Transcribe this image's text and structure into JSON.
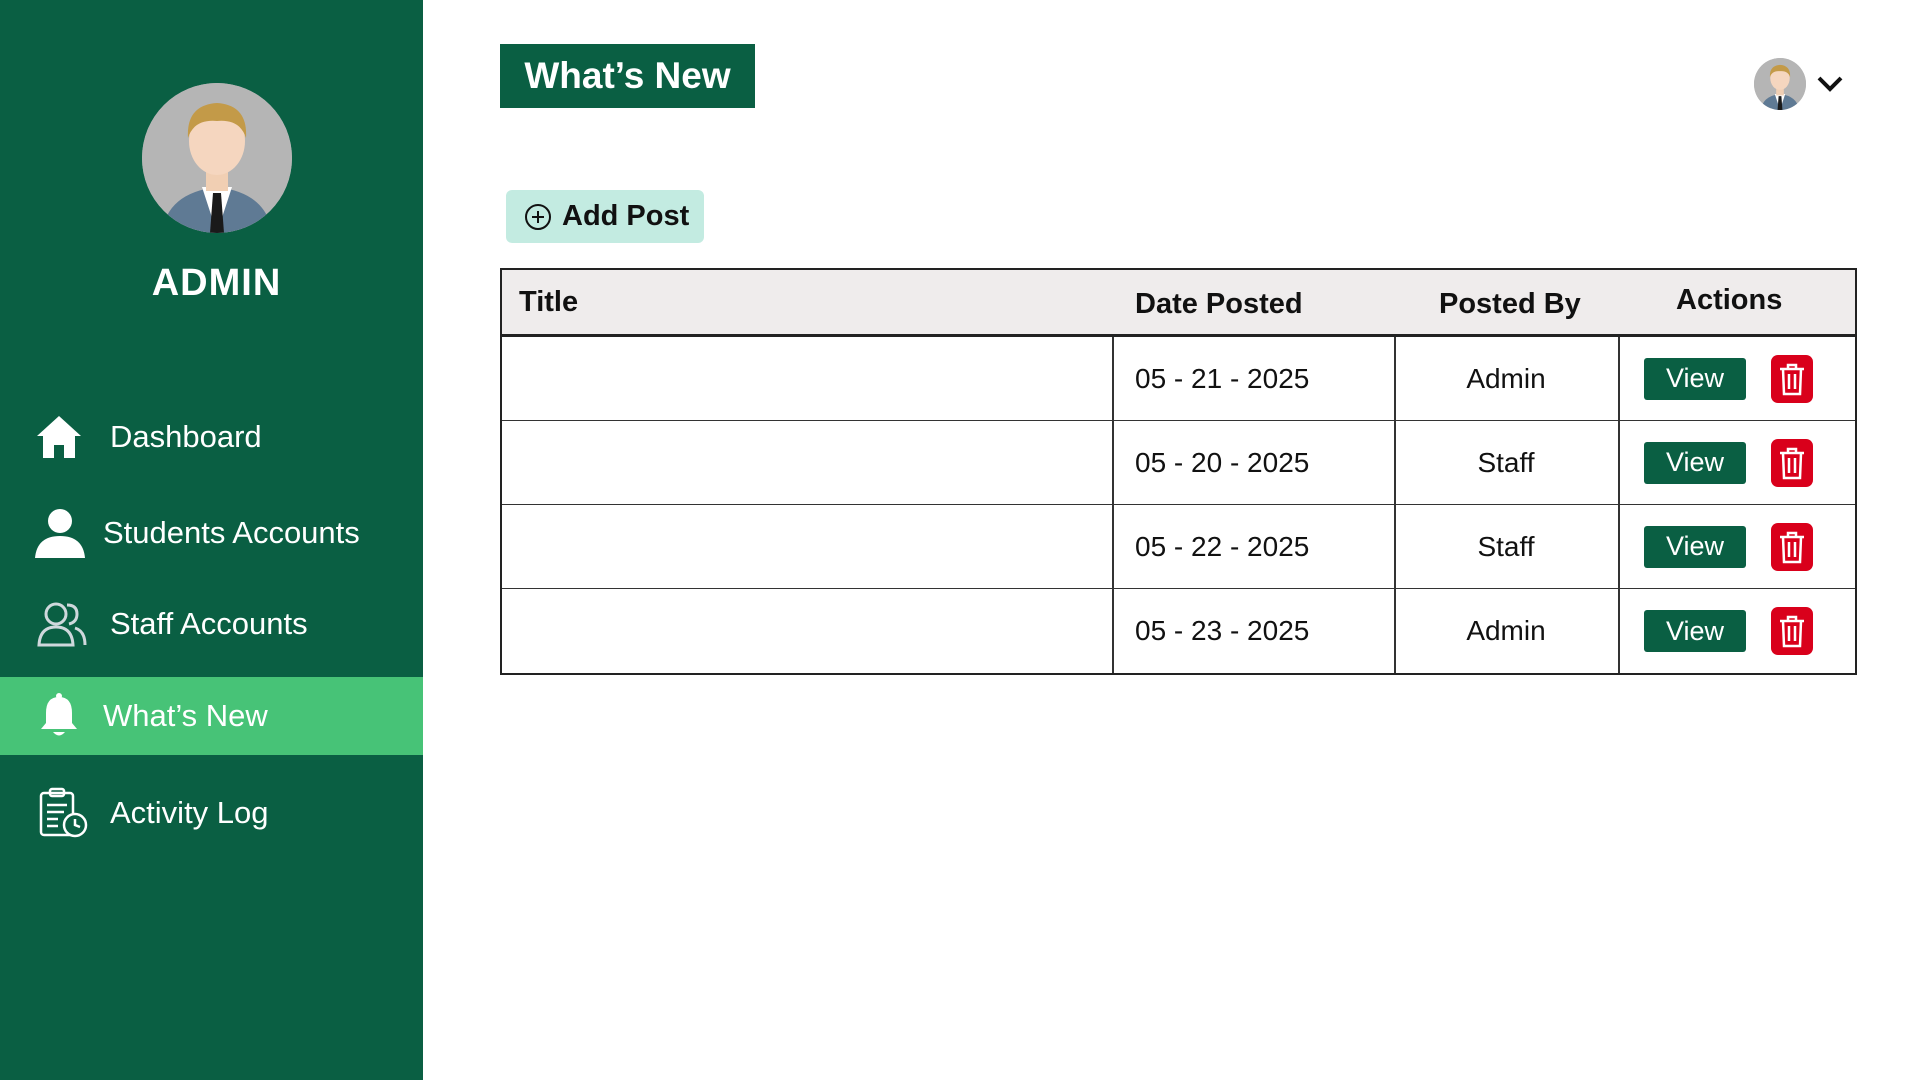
{
  "sidebar": {
    "role": "ADMIN",
    "items": [
      {
        "label": "Dashboard",
        "icon": "home-icon"
      },
      {
        "label": "Students Accounts",
        "icon": "user-icon"
      },
      {
        "label": "Staff Accounts",
        "icon": "users-icon"
      },
      {
        "label": "What’s New",
        "icon": "bell-icon",
        "active": true
      },
      {
        "label": "Activity Log",
        "icon": "clipboard-clock-icon"
      }
    ]
  },
  "header": {
    "title": "What’s New"
  },
  "toolbar": {
    "add_post_label": "Add Post"
  },
  "table": {
    "columns": [
      "Title",
      "Date Posted",
      "Posted By",
      "Actions"
    ],
    "rows": [
      {
        "title": "",
        "date": "05 - 21 - 2025",
        "posted_by": "Admin",
        "view_label": "View"
      },
      {
        "title": "",
        "date": "05 - 20 - 2025",
        "posted_by": "Staff",
        "view_label": "View"
      },
      {
        "title": "",
        "date": "05 - 22 - 2025",
        "posted_by": "Staff",
        "view_label": "View"
      },
      {
        "title": "",
        "date": "05 - 23 - 2025",
        "posted_by": "Admin",
        "view_label": "View"
      }
    ]
  },
  "colors": {
    "brand_green": "#0a5f43",
    "active_green": "#47c377",
    "delete_red": "#d9001b",
    "add_button_bg": "#c3ebe1"
  }
}
